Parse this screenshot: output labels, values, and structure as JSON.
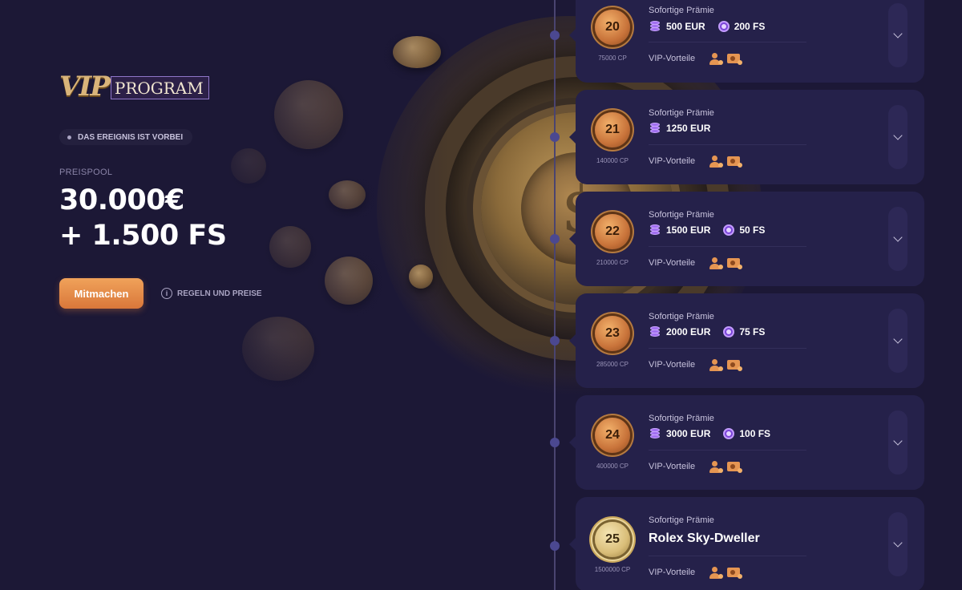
{
  "logo": {
    "vip": "VIP",
    "program": "PROGRAM"
  },
  "event_status": "DAS EREIGNIS IST VORBEI",
  "prize_pool": {
    "label": "PREISPOOL",
    "line1": "30.000€",
    "line2": "+ 1.500 FS"
  },
  "join_button": "Mitmachen",
  "rules_link": "REGELN UND PREISE",
  "info_icon": "i",
  "levels": [
    {
      "level": "20",
      "cp": "75000 CP",
      "reward_label": "Sofortige Prämie",
      "cash": "500 EUR",
      "spins": "200 FS",
      "vip_label": "VIP-Vorteile"
    },
    {
      "level": "21",
      "cp": "140000 CP",
      "reward_label": "Sofortige Prämie",
      "cash": "1250 EUR",
      "vip_label": "VIP-Vorteile"
    },
    {
      "level": "22",
      "cp": "210000 CP",
      "reward_label": "Sofortige Prämie",
      "cash": "1500 EUR",
      "spins": "50 FS",
      "vip_label": "VIP-Vorteile"
    },
    {
      "level": "23",
      "cp": "285000 CP",
      "reward_label": "Sofortige Prämie",
      "cash": "2000 EUR",
      "spins": "75 FS",
      "vip_label": "VIP-Vorteile"
    },
    {
      "level": "24",
      "cp": "400000 CP",
      "reward_label": "Sofortige Prämie",
      "cash": "3000 EUR",
      "spins": "100 FS",
      "vip_label": "VIP-Vorteile"
    },
    {
      "level": "25",
      "cp": "1500000 CP",
      "reward_label": "Sofortige Prämie",
      "big_reward": "Rolex Sky-Dweller",
      "vip_label": "VIP-Vorteile"
    }
  ],
  "colors": {
    "background": "#1c1836",
    "card": "#25214a",
    "accent_orange": "#e59552",
    "accent_purple": "#a06ef0"
  },
  "icons": {
    "coins": "coins-icon",
    "spins": "free-spins-icon",
    "vip_person": "vip-manager-icon",
    "vip_ticket": "vip-ticket-icon",
    "expand": "chevron-down-icon"
  }
}
